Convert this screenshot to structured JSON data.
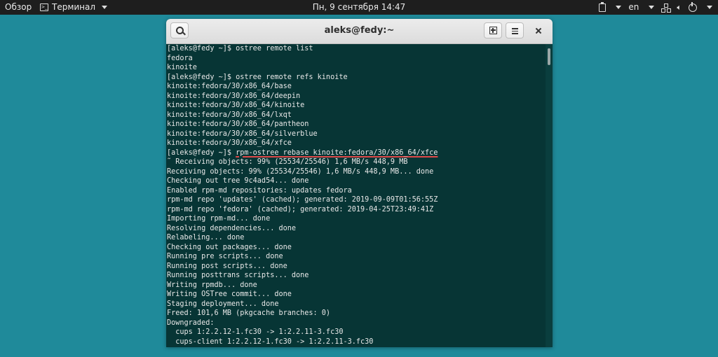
{
  "topbar": {
    "activities": "Обзор",
    "app_name": "Терминал",
    "clock": "Пн, 9 сентября  14:47",
    "language": "en"
  },
  "window": {
    "title": "aleks@fedy:~"
  },
  "icons": {
    "search": "search-icon",
    "new_tab": "new-tab-icon",
    "menu": "hamburger-menu-icon",
    "close": "close-icon"
  },
  "colors": {
    "desktop": "#1f8a9a",
    "terminal_bg": "#073535",
    "underline": "#e04848"
  },
  "terminal": {
    "lines": [
      {
        "text": "[aleks@fedy ~]$ ostree remote list"
      },
      {
        "text": "fedora"
      },
      {
        "text": "kinoite"
      },
      {
        "text": "[aleks@fedy ~]$ ostree remote refs kinoite"
      },
      {
        "text": "kinoite:fedora/30/x86_64/base"
      },
      {
        "text": "kinoite:fedora/30/x86_64/deepin"
      },
      {
        "text": "kinoite:fedora/30/x86_64/kinoite"
      },
      {
        "text": "kinoite:fedora/30/x86_64/lxqt"
      },
      {
        "text": "kinoite:fedora/30/x86_64/pantheon"
      },
      {
        "text": "kinoite:fedora/30/x86_64/silverblue"
      },
      {
        "text": "kinoite:fedora/30/x86_64/xfce"
      },
      {
        "prompt": "[aleks@fedy ~]$ ",
        "cmd": "rpm-ostree rebase kinoite:fedora/30/x86_64/xfce"
      },
      {
        "text": "˜ Receiving objects: 99% (25534/25546) 1,6 MB/s 448,9 MB"
      },
      {
        "text": "Receiving objects: 99% (25534/25546) 1,6 MB/s 448,9 MB... done"
      },
      {
        "text": "Checking out tree 9c4ad54... done"
      },
      {
        "text": "Enabled rpm-md repositories: updates fedora"
      },
      {
        "text": "rpm-md repo 'updates' (cached); generated: 2019-09-09T01:56:55Z"
      },
      {
        "text": "rpm-md repo 'fedora' (cached); generated: 2019-04-25T23:49:41Z"
      },
      {
        "text": "Importing rpm-md... done"
      },
      {
        "text": "Resolving dependencies... done"
      },
      {
        "text": "Relabeling... done"
      },
      {
        "text": "Checking out packages... done"
      },
      {
        "text": "Running pre scripts... done"
      },
      {
        "text": "Running post scripts... done"
      },
      {
        "text": "Running posttrans scripts... done"
      },
      {
        "text": "Writing rpmdb... done"
      },
      {
        "text": "Writing OSTree commit... done"
      },
      {
        "text": "Staging deployment... done"
      },
      {
        "text": "Freed: 101,6 MB (pkgcache branches: 0)"
      },
      {
        "text": "Downgraded:"
      },
      {
        "text": "  cups 1:2.2.12-1.fc30 -> 1:2.2.11-3.fc30"
      },
      {
        "text": "  cups-client 1:2.2.12-1.fc30 -> 1:2.2.11-3.fc30"
      }
    ]
  }
}
